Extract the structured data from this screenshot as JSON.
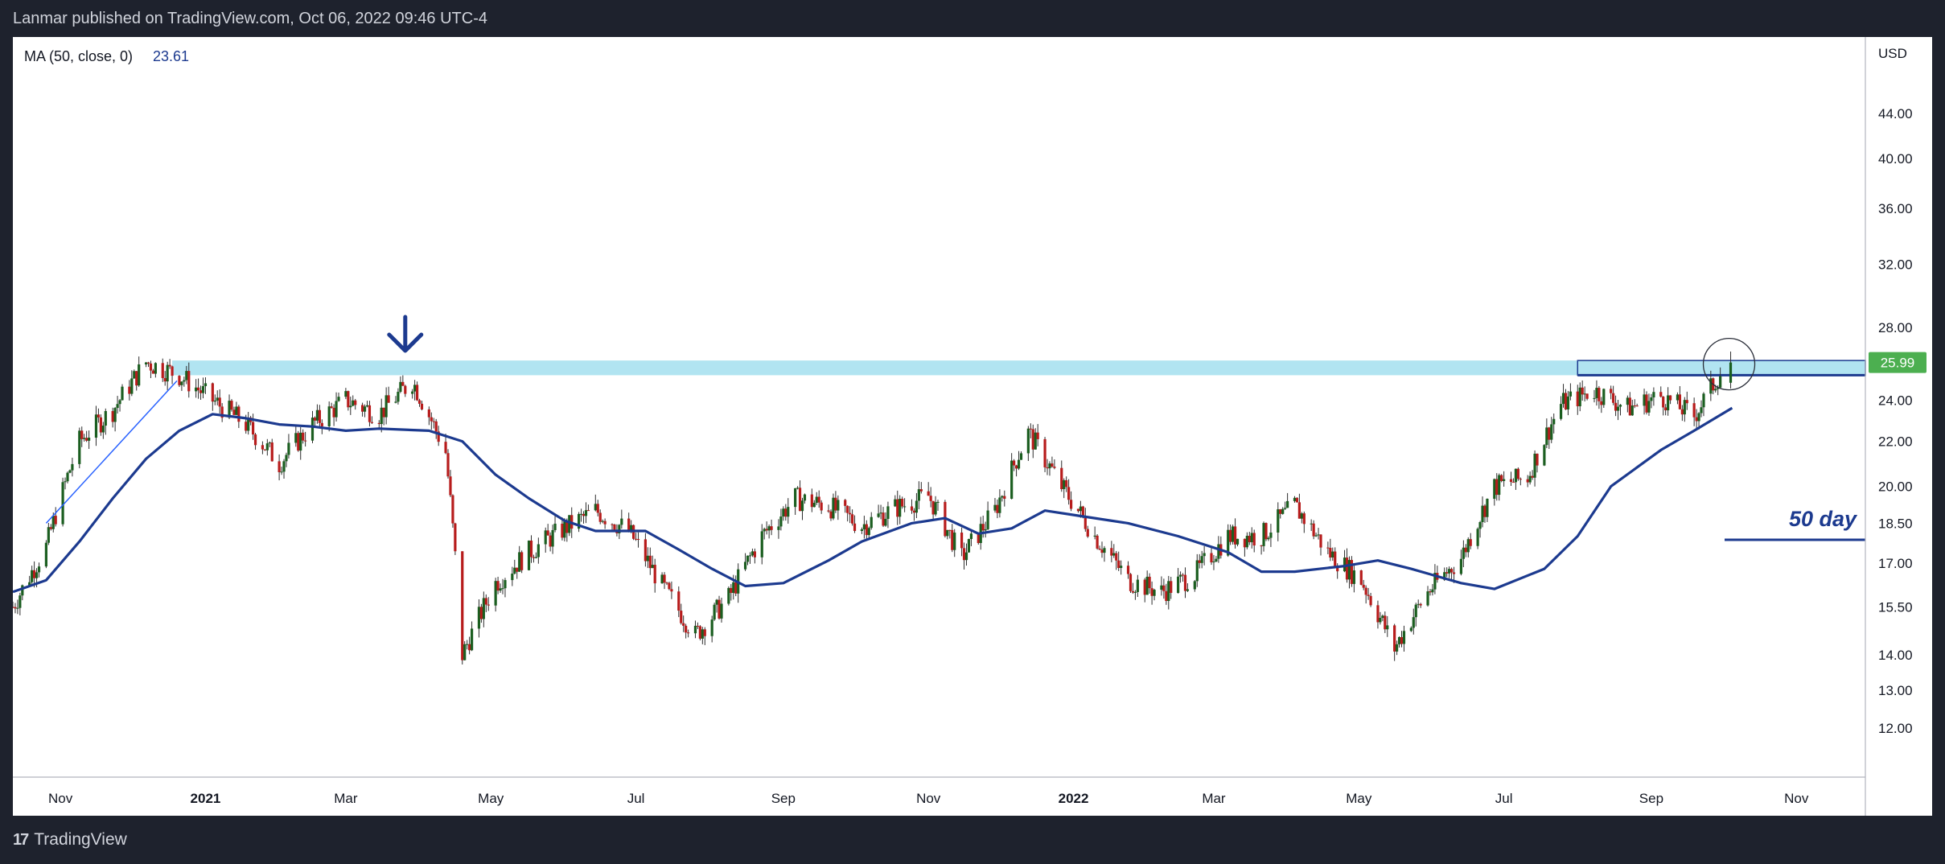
{
  "header": {
    "published": "Lanmar published on TradingView.com, Oct 06, 2022 09:46 UTC-4"
  },
  "footer": {
    "brand": "TradingView",
    "logo_icon": "tradingview-logo-icon"
  },
  "indicator": {
    "label": "MA (50, close, 0)",
    "value": "23.61",
    "value_color": "#1c3a8f"
  },
  "annotations": {
    "fifty_day_label": "50 day",
    "resistance_zone_color": "#a8e1f0",
    "ma_color": "#1c3a8f",
    "arrow_icon": "down-arrow-icon",
    "circle_marker": "highlight-circle"
  },
  "chart_data": {
    "type": "line",
    "currency": "USD",
    "scale": "log",
    "y_ticks": [
      "44.00",
      "40.00",
      "36.00",
      "32.00",
      "28.00",
      "24.00",
      "22.00",
      "20.00",
      "18.50",
      "17.00",
      "15.50",
      "14.00",
      "13.00",
      "12.00"
    ],
    "ylim": [
      11.0,
      50.0
    ],
    "x_ticks": [
      "Nov",
      "2021",
      "Mar",
      "May",
      "Jul",
      "Sep",
      "Nov",
      "2022",
      "Mar",
      "May",
      "Jul",
      "Sep",
      "Nov"
    ],
    "x_range": [
      "2020-10-12",
      "2022-11-30"
    ],
    "last_price": "25.99",
    "last_price_color": "#4caf50",
    "resistance_zone": {
      "low": 25.3,
      "high": 26.1
    },
    "price_series": {
      "name": "",
      "x": [
        "2020-10-12",
        "2020-10-26",
        "2020-11-09",
        "2020-11-23",
        "2020-12-07",
        "2020-12-21",
        "2021-01-04",
        "2021-01-18",
        "2021-02-01",
        "2021-02-15",
        "2021-03-01",
        "2021-03-15",
        "2021-03-29",
        "2021-04-12",
        "2021-04-19",
        "2021-05-03",
        "2021-05-17",
        "2021-06-01",
        "2021-06-14",
        "2021-06-28",
        "2021-07-12",
        "2021-07-26",
        "2021-08-09",
        "2021-08-23",
        "2021-09-06",
        "2021-09-20",
        "2021-10-04",
        "2021-10-18",
        "2021-11-01",
        "2021-11-15",
        "2021-11-29",
        "2021-12-13",
        "2021-12-27",
        "2022-01-10",
        "2022-01-24",
        "2022-02-07",
        "2022-02-21",
        "2022-03-07",
        "2022-03-21",
        "2022-04-04",
        "2022-04-18",
        "2022-05-02",
        "2022-05-16",
        "2022-05-30",
        "2022-06-13",
        "2022-06-27",
        "2022-07-11",
        "2022-07-25",
        "2022-08-08",
        "2022-08-22",
        "2022-09-05",
        "2022-09-19",
        "2022-10-03"
      ],
      "values": [
        15.5,
        17.6,
        22.0,
        23.5,
        26.0,
        25.3,
        24.0,
        22.8,
        21.0,
        22.8,
        24.0,
        23.3,
        25.0,
        21.5,
        14.0,
        16.3,
        17.4,
        18.3,
        19.0,
        18.2,
        16.2,
        14.6,
        15.8,
        18.0,
        19.5,
        19.2,
        18.4,
        19.1,
        19.6,
        17.2,
        19.0,
        22.4,
        20.0,
        18.0,
        16.4,
        16.0,
        16.6,
        18.0,
        18.0,
        19.2,
        17.4,
        16.4,
        14.2,
        16.0,
        17.2,
        20.0,
        20.4,
        23.8,
        24.5,
        23.6,
        24.2,
        23.2,
        25.99
      ]
    },
    "ma_series": {
      "name": "MA (50, close, 0)",
      "x": [
        "2020-10-12",
        "2020-10-26",
        "2020-11-09",
        "2020-11-23",
        "2020-12-07",
        "2020-12-21",
        "2021-01-04",
        "2021-01-18",
        "2021-02-01",
        "2021-02-15",
        "2021-03-01",
        "2021-03-15",
        "2021-04-05",
        "2021-04-19",
        "2021-05-03",
        "2021-05-17",
        "2021-06-01",
        "2021-06-14",
        "2021-07-05",
        "2021-07-19",
        "2021-08-02",
        "2021-08-16",
        "2021-09-01",
        "2021-09-20",
        "2021-10-04",
        "2021-10-25",
        "2021-11-08",
        "2021-11-22",
        "2021-12-06",
        "2021-12-20",
        "2022-01-03",
        "2022-01-24",
        "2022-02-14",
        "2022-03-07",
        "2022-03-21",
        "2022-04-04",
        "2022-04-25",
        "2022-05-09",
        "2022-05-23",
        "2022-06-13",
        "2022-06-27",
        "2022-07-18",
        "2022-08-01",
        "2022-08-15",
        "2022-09-05",
        "2022-09-19",
        "2022-10-05"
      ],
      "values": [
        16.0,
        16.4,
        17.8,
        19.5,
        21.2,
        22.5,
        23.3,
        23.1,
        22.8,
        22.7,
        22.5,
        22.6,
        22.5,
        22.0,
        20.5,
        19.5,
        18.6,
        18.2,
        18.2,
        17.5,
        16.8,
        16.2,
        16.3,
        17.1,
        17.8,
        18.5,
        18.7,
        18.1,
        18.3,
        19.0,
        18.8,
        18.5,
        18.0,
        17.4,
        16.7,
        16.7,
        16.9,
        17.1,
        16.8,
        16.3,
        16.1,
        16.8,
        18.0,
        20.0,
        21.6,
        22.5,
        23.61
      ]
    }
  }
}
